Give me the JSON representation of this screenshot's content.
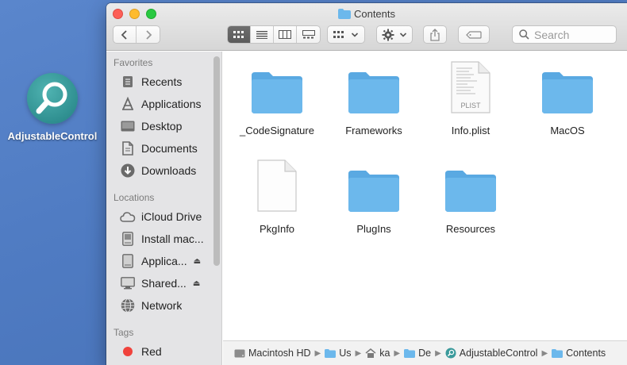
{
  "desktop": {
    "app_label": "AdjustableControl"
  },
  "window": {
    "title": "Contents"
  },
  "toolbar": {
    "search_placeholder": "Search"
  },
  "sidebar": {
    "sections": [
      {
        "heading": "Favorites",
        "items": [
          {
            "label": "Recents",
            "icon": "clock-icon"
          },
          {
            "label": "Applications",
            "icon": "applications-icon"
          },
          {
            "label": "Desktop",
            "icon": "desktop-icon"
          },
          {
            "label": "Documents",
            "icon": "documents-icon"
          },
          {
            "label": "Downloads",
            "icon": "downloads-icon"
          }
        ]
      },
      {
        "heading": "Locations",
        "items": [
          {
            "label": "iCloud Drive",
            "icon": "cloud-icon"
          },
          {
            "label": "Install mac...",
            "icon": "disk-icon"
          },
          {
            "label": "Applica...",
            "icon": "drive-icon",
            "eject": true
          },
          {
            "label": "Shared...",
            "icon": "display-icon",
            "eject": true
          },
          {
            "label": "Network",
            "icon": "globe-icon"
          }
        ]
      },
      {
        "heading": "Tags",
        "items": [
          {
            "label": "Red",
            "icon": "tag-dot-icon",
            "color": "#f0423c"
          }
        ]
      }
    ]
  },
  "files": [
    {
      "name": "_CodeSignature",
      "kind": "folder"
    },
    {
      "name": "Frameworks",
      "kind": "folder"
    },
    {
      "name": "Info.plist",
      "kind": "plist",
      "badge": "PLIST"
    },
    {
      "name": "MacOS",
      "kind": "folder"
    },
    {
      "name": "PkgInfo",
      "kind": "document"
    },
    {
      "name": "PlugIns",
      "kind": "folder"
    },
    {
      "name": "Resources",
      "kind": "folder"
    }
  ],
  "pathbar": [
    {
      "label": "Macintosh HD",
      "icon": "hd-icon"
    },
    {
      "label": "Us",
      "icon": "folder-icon"
    },
    {
      "label": "ka",
      "icon": "home-icon"
    },
    {
      "label": "De",
      "icon": "folder-icon"
    },
    {
      "label": "AdjustableControl",
      "icon": "app-icon"
    },
    {
      "label": "Contents",
      "icon": "folder-icon"
    }
  ],
  "colors": {
    "folder": "#6cb8ec",
    "folder_tab": "#5aa9e2",
    "desktop_bg": "#4f7bc2",
    "tag_red": "#f0423c"
  }
}
